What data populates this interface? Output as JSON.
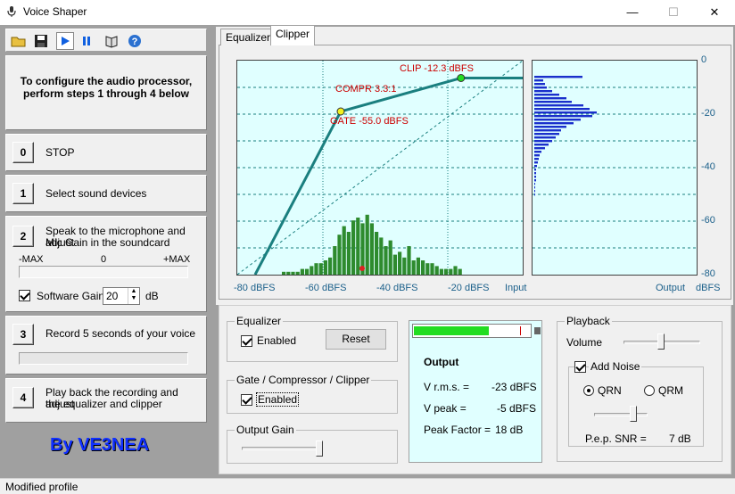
{
  "window": {
    "title": "Voice Shaper",
    "minimize": "—",
    "maximize": "☐",
    "close": "✕"
  },
  "instructions": "To configure the audio processor, perform steps 1 through 4 below",
  "steps": [
    {
      "num": "0",
      "text": "STOP"
    },
    {
      "num": "1",
      "text": "Select sound devices"
    },
    {
      "num": "2",
      "text_l1": "Speak to the microphone and adjust",
      "text_l2": "Mic Gain in the soundcard"
    },
    {
      "num": "3",
      "text": "Record 5 seconds of your voice"
    },
    {
      "num": "4",
      "text_l1": "Play back the recording and adjust",
      "text_l2": "the equalizer and clipper"
    }
  ],
  "mic_gain": {
    "min_label": "-MAX",
    "mid_label": "0",
    "max_label": "+MAX"
  },
  "software_gain": {
    "label": "Software Gain",
    "value": "20",
    "unit": "dB",
    "checked": true
  },
  "record_progress": 0,
  "credit": "By VE3NEA",
  "tabs": [
    "Equalizer",
    "Clipper"
  ],
  "active_tab": "Clipper",
  "transfer": {
    "clip_label": "CLIP  -12.3 dBFS",
    "compr_label": "COMPR  3.3:1",
    "gate_label": "GATE  -55.0 dBFS",
    "x_ticks": [
      "-80 dBFS",
      "-60 dBFS",
      "-40 dBFS",
      "-20 dBFS"
    ],
    "x_axis": "Input",
    "hist_values": [
      1,
      1,
      1,
      1,
      2,
      2,
      3,
      4,
      4,
      5,
      6,
      10,
      14,
      17,
      15,
      19,
      20,
      18,
      21,
      18,
      15,
      13,
      10,
      12,
      7,
      8,
      6,
      10,
      5,
      6,
      5,
      4,
      4,
      3,
      2,
      2,
      2,
      3,
      2
    ]
  },
  "output_hist": {
    "y_ticks": [
      "0",
      "-20",
      "-40",
      "-60",
      "-80"
    ],
    "x_axis": "Output",
    "unit": "dBFS",
    "bars": [
      54,
      10,
      12,
      14,
      20,
      28,
      36,
      42,
      55,
      62,
      70,
      65,
      52,
      44,
      36,
      30,
      28,
      24,
      20,
      16,
      12,
      8,
      6,
      5,
      4,
      3,
      2,
      2,
      2,
      2,
      1,
      1,
      1,
      1
    ]
  },
  "equalizer_group": {
    "title": "Equalizer",
    "enabled_label": "Enabled",
    "reset_label": "Reset"
  },
  "gate_group": {
    "title": "Gate / Compressor / Clipper",
    "enabled_label": "Enabled"
  },
  "output_gain_group": {
    "title": "Output Gain"
  },
  "output_meter": {
    "level": 0.6
  },
  "output": {
    "title": "Output",
    "vrms_label": "V r.m.s. =",
    "vrms_value": "-23 dBFS",
    "vpeak_label": "V peak =",
    "vpeak_value": "-5 dBFS",
    "pf_label": "Peak Factor =",
    "pf_value": "18 dB"
  },
  "playback": {
    "title": "Playback",
    "volume_label": "Volume",
    "add_noise_label": "Add Noise",
    "qrn_label": "QRN",
    "qrm_label": "QRM",
    "snr_label": "P.e.p. SNR =",
    "snr_value": "7 dB"
  },
  "status": "Modified profile",
  "colors": {
    "curve": "#1a7f7f",
    "graph_bg": "#e0ffff",
    "hist": "#2e8b2e",
    "outbars": "#1a2fcc",
    "label_red": "#cc0000",
    "meter": "#22dd22",
    "credit": "#1030ff"
  }
}
